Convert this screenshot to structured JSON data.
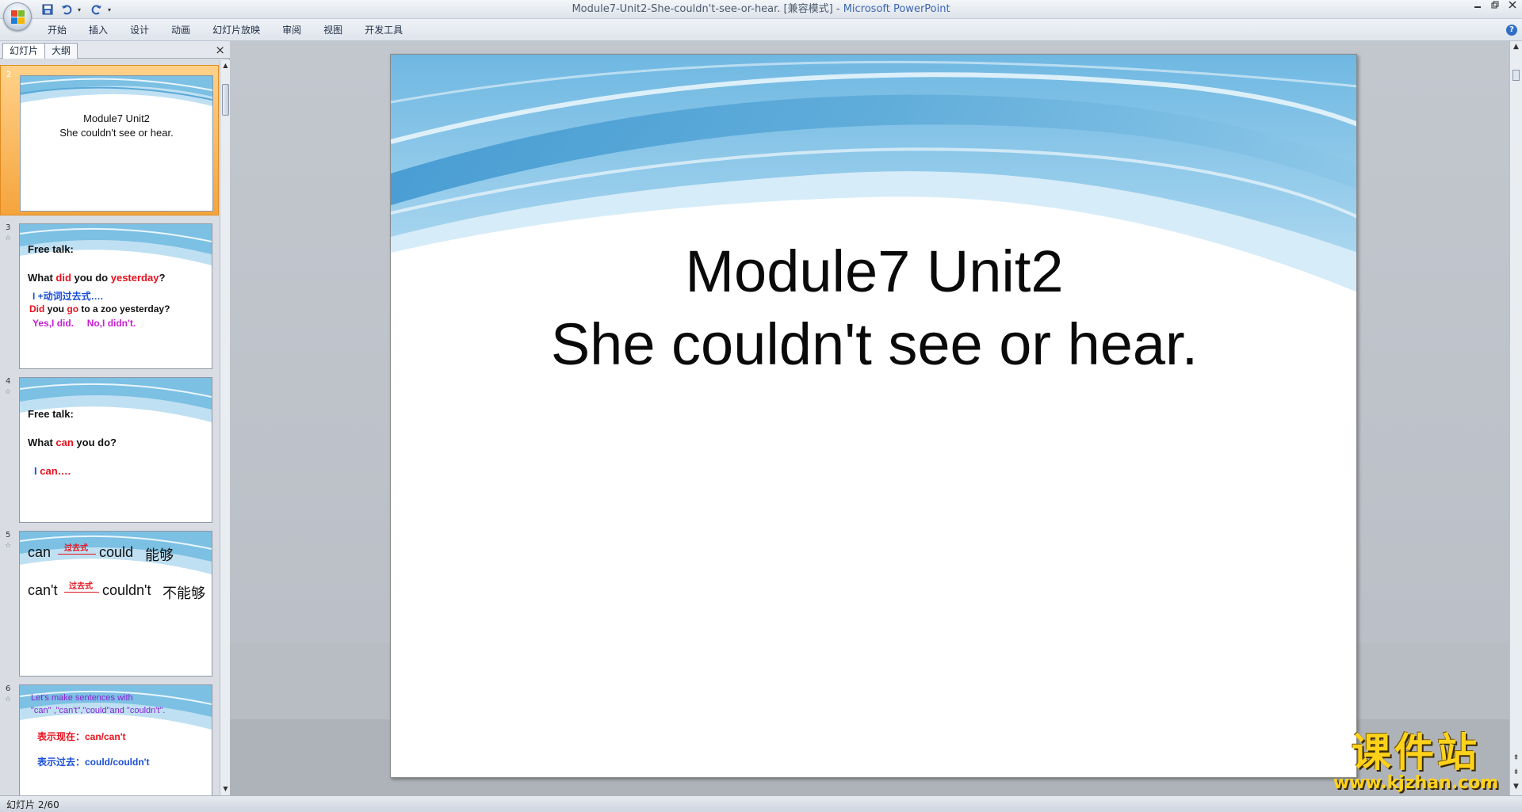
{
  "window": {
    "title_doc": "Module7-Unit2-She-couldn't-see-or-hear. [兼容模式]",
    "title_sep": " - ",
    "title_app": "Microsoft PowerPoint"
  },
  "qat": {
    "save_icon": "save-icon",
    "undo_icon": "undo-icon",
    "redo_icon": "redo-icon"
  },
  "ribbon": {
    "tabs": [
      "开始",
      "插入",
      "设计",
      "动画",
      "幻灯片放映",
      "审阅",
      "视图",
      "开发工具"
    ]
  },
  "pane": {
    "tab_slides": "幻灯片",
    "tab_outline": "大纲",
    "close": "×"
  },
  "thumbnails": [
    {
      "num": "2",
      "line1": "Module7 Unit2",
      "line2": "She couldn't see or hear."
    },
    {
      "num": "3",
      "heading": "Free talk:",
      "q_what": "What ",
      "q_did": "did",
      "q_you_do": " you do ",
      "q_yesterday": "yesterday",
      "q_mark": "?",
      "pattern": "I +动词过去式….",
      "did": "Did",
      "you": " you ",
      "go": "go",
      "zoo": " to a zoo yesterday?",
      "answers": "Yes,I did.     No,I didn't."
    },
    {
      "num": "4",
      "heading": "Free talk:",
      "q_what": "What ",
      "q_can": "can",
      "q_rest": " you do?",
      "ans_i": "I ",
      "ans_can": "can….",
      "ans_dots": ""
    },
    {
      "num": "5",
      "can": "can",
      "past1": "过去式",
      "could": "could",
      "able": "能够",
      "cant": "can't",
      "past2": "过去式",
      "couldnt": "couldn't",
      "unable": "不能够"
    },
    {
      "num": "6",
      "line1": "Let's make sentences with",
      "line2": "\"can\" ,\"can't\",\"could\"and \"couldn't\".",
      "present": "表示现在：can/can't",
      "past": "表示过去：could/couldn't"
    }
  ],
  "slide": {
    "title_line1": "Module7 Unit2",
    "title_line2": "She couldn't see or hear."
  },
  "statusbar": {
    "slide_info": "幻灯片 2/60"
  },
  "watermark": {
    "text_cn": "课件站",
    "url": "www.kjzhan.com"
  },
  "colors": {
    "wave_dark": "#5aa9d8",
    "wave_light": "#bfe0f2",
    "selected_thumb": "#f5a43c"
  }
}
